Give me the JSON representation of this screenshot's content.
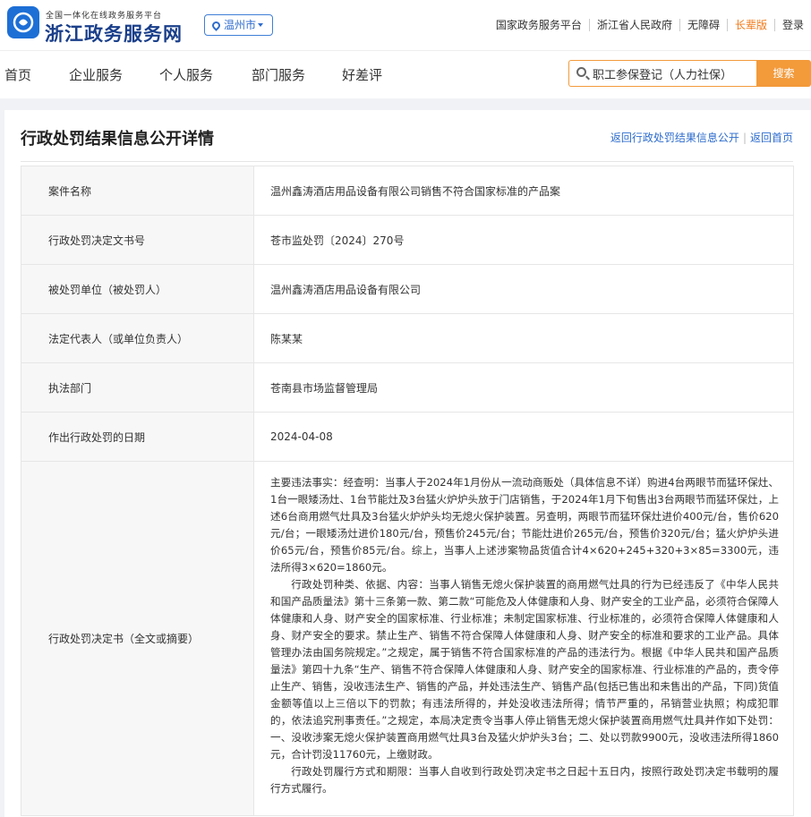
{
  "header": {
    "brand_sub": "全国一体化在线政务服务平台",
    "brand_main": "浙江政务服务网",
    "city": "温州市",
    "links": [
      "国家政务服务平台",
      "浙江省人民政府",
      "无障碍",
      "长辈版",
      "登录"
    ]
  },
  "nav": {
    "items": [
      "首页",
      "企业服务",
      "个人服务",
      "部门服务",
      "好差评"
    ],
    "search_value": "职工参保登记（人力社保）",
    "search_button": "搜索"
  },
  "page": {
    "title": "行政处罚结果信息公开详情",
    "back_list": "返回行政处罚结果信息公开",
    "back_home": "返回首页"
  },
  "details": {
    "rows": [
      {
        "label": "案件名称",
        "value": "温州鑫涛酒店用品设备有限公司销售不符合国家标准的产品案"
      },
      {
        "label": "行政处罚决定文书号",
        "value": "苍市监处罚〔2024〕270号"
      },
      {
        "label": "被处罚单位（被处罚人）",
        "value": "温州鑫涛酒店用品设备有限公司"
      },
      {
        "label": "法定代表人（或单位负责人）",
        "value": "陈某某"
      },
      {
        "label": "执法部门",
        "value": "苍南县市场监督管理局"
      },
      {
        "label": "作出行政处罚的日期",
        "value": "2024-04-08"
      }
    ],
    "decision_label": "行政处罚决定书（全文或摘要）",
    "decision_paragraphs": [
      "主要违法事实：经查明：当事人于2024年1月份从一流动商贩处（具体信息不详）购进4台两眼节而猛环保灶、1台一眼矮汤灶、1台节能灶及3台猛火炉炉头放于门店销售，于2024年1月下旬售出3台两眼节而猛环保灶，上述6台商用燃气灶具及3台猛火炉炉头均无熄火保护装置。另查明，两眼节而猛环保灶进价400元/台，售价620元/台；一眼矮汤灶进价180元/台，预售价245元/台；节能灶进价265元/台，预售价320元/台；猛火炉炉头进价65元/台，预售价85元/台。综上，当事人上述涉案物品货值合计4×620+245+320+3×85=3300元，违法所得3×620=1860元。",
      "行政处罚种类、依据、内容：当事人销售无熄火保护装置的商用燃气灶具的行为已经违反了《中华人民共和国产品质量法》第十三条第一款、第二款“可能危及人体健康和人身、财产安全的工业产品，必须符合保障人体健康和人身、财产安全的国家标准、行业标准；未制定国家标准、行业标准的，必须符合保障人体健康和人身、财产安全的要求。禁止生产、销售不符合保障人体健康和人身、财产安全的标准和要求的工业产品。具体管理办法由国务院规定。”之规定，属于销售不符合国家标准的产品的违法行为。根据《中华人民共和国产品质量法》第四十九条“生产、销售不符合保障人体健康和人身、财产安全的国家标准、行业标准的产品的，责令停止生产、销售，没收违法生产、销售的产品，并处违法生产、销售产品(包括已售出和未售出的产品，下同)货值金额等值以上三倍以下的罚款；有违法所得的，并处没收违法所得；情节严重的，吊销营业执照；构成犯罪的，依法追究刑事责任。”之规定，本局决定责令当事人停止销售无熄火保护装置商用燃气灶具并作如下处罚：一、没收涉案无熄火保护装置商用燃气灶具3台及猛火炉炉头3台；二、处以罚款9900元，没收违法所得1860元，合计罚没11760元，上缴财政。",
      "行政处罚履行方式和期限：当事人自收到行政处罚决定书之日起十五日内，按照行政处罚决定书载明的履行方式履行。"
    ]
  }
}
